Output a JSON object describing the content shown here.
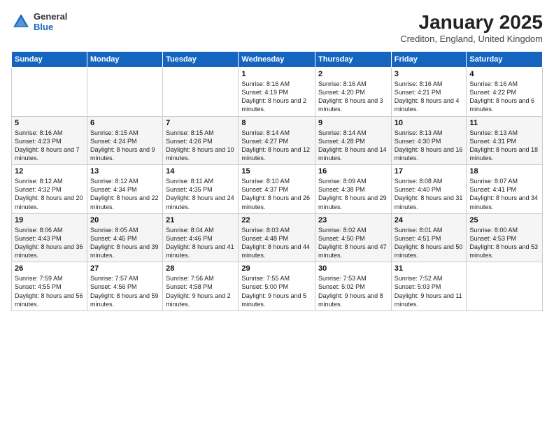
{
  "header": {
    "logo_general": "General",
    "logo_blue": "Blue",
    "month_title": "January 2025",
    "location": "Crediton, England, United Kingdom"
  },
  "weekdays": [
    "Sunday",
    "Monday",
    "Tuesday",
    "Wednesday",
    "Thursday",
    "Friday",
    "Saturday"
  ],
  "weeks": [
    [
      {
        "day": "",
        "info": ""
      },
      {
        "day": "",
        "info": ""
      },
      {
        "day": "",
        "info": ""
      },
      {
        "day": "1",
        "info": "Sunrise: 8:16 AM\nSunset: 4:19 PM\nDaylight: 8 hours and 2 minutes."
      },
      {
        "day": "2",
        "info": "Sunrise: 8:16 AM\nSunset: 4:20 PM\nDaylight: 8 hours and 3 minutes."
      },
      {
        "day": "3",
        "info": "Sunrise: 8:16 AM\nSunset: 4:21 PM\nDaylight: 8 hours and 4 minutes."
      },
      {
        "day": "4",
        "info": "Sunrise: 8:16 AM\nSunset: 4:22 PM\nDaylight: 8 hours and 6 minutes."
      }
    ],
    [
      {
        "day": "5",
        "info": "Sunrise: 8:16 AM\nSunset: 4:23 PM\nDaylight: 8 hours and 7 minutes."
      },
      {
        "day": "6",
        "info": "Sunrise: 8:15 AM\nSunset: 4:24 PM\nDaylight: 8 hours and 9 minutes."
      },
      {
        "day": "7",
        "info": "Sunrise: 8:15 AM\nSunset: 4:26 PM\nDaylight: 8 hours and 10 minutes."
      },
      {
        "day": "8",
        "info": "Sunrise: 8:14 AM\nSunset: 4:27 PM\nDaylight: 8 hours and 12 minutes."
      },
      {
        "day": "9",
        "info": "Sunrise: 8:14 AM\nSunset: 4:28 PM\nDaylight: 8 hours and 14 minutes."
      },
      {
        "day": "10",
        "info": "Sunrise: 8:13 AM\nSunset: 4:30 PM\nDaylight: 8 hours and 16 minutes."
      },
      {
        "day": "11",
        "info": "Sunrise: 8:13 AM\nSunset: 4:31 PM\nDaylight: 8 hours and 18 minutes."
      }
    ],
    [
      {
        "day": "12",
        "info": "Sunrise: 8:12 AM\nSunset: 4:32 PM\nDaylight: 8 hours and 20 minutes."
      },
      {
        "day": "13",
        "info": "Sunrise: 8:12 AM\nSunset: 4:34 PM\nDaylight: 8 hours and 22 minutes."
      },
      {
        "day": "14",
        "info": "Sunrise: 8:11 AM\nSunset: 4:35 PM\nDaylight: 8 hours and 24 minutes."
      },
      {
        "day": "15",
        "info": "Sunrise: 8:10 AM\nSunset: 4:37 PM\nDaylight: 8 hours and 26 minutes."
      },
      {
        "day": "16",
        "info": "Sunrise: 8:09 AM\nSunset: 4:38 PM\nDaylight: 8 hours and 29 minutes."
      },
      {
        "day": "17",
        "info": "Sunrise: 8:08 AM\nSunset: 4:40 PM\nDaylight: 8 hours and 31 minutes."
      },
      {
        "day": "18",
        "info": "Sunrise: 8:07 AM\nSunset: 4:41 PM\nDaylight: 8 hours and 34 minutes."
      }
    ],
    [
      {
        "day": "19",
        "info": "Sunrise: 8:06 AM\nSunset: 4:43 PM\nDaylight: 8 hours and 36 minutes."
      },
      {
        "day": "20",
        "info": "Sunrise: 8:05 AM\nSunset: 4:45 PM\nDaylight: 8 hours and 39 minutes."
      },
      {
        "day": "21",
        "info": "Sunrise: 8:04 AM\nSunset: 4:46 PM\nDaylight: 8 hours and 41 minutes."
      },
      {
        "day": "22",
        "info": "Sunrise: 8:03 AM\nSunset: 4:48 PM\nDaylight: 8 hours and 44 minutes."
      },
      {
        "day": "23",
        "info": "Sunrise: 8:02 AM\nSunset: 4:50 PM\nDaylight: 8 hours and 47 minutes."
      },
      {
        "day": "24",
        "info": "Sunrise: 8:01 AM\nSunset: 4:51 PM\nDaylight: 8 hours and 50 minutes."
      },
      {
        "day": "25",
        "info": "Sunrise: 8:00 AM\nSunset: 4:53 PM\nDaylight: 8 hours and 53 minutes."
      }
    ],
    [
      {
        "day": "26",
        "info": "Sunrise: 7:59 AM\nSunset: 4:55 PM\nDaylight: 8 hours and 56 minutes."
      },
      {
        "day": "27",
        "info": "Sunrise: 7:57 AM\nSunset: 4:56 PM\nDaylight: 8 hours and 59 minutes."
      },
      {
        "day": "28",
        "info": "Sunrise: 7:56 AM\nSunset: 4:58 PM\nDaylight: 9 hours and 2 minutes."
      },
      {
        "day": "29",
        "info": "Sunrise: 7:55 AM\nSunset: 5:00 PM\nDaylight: 9 hours and 5 minutes."
      },
      {
        "day": "30",
        "info": "Sunrise: 7:53 AM\nSunset: 5:02 PM\nDaylight: 9 hours and 8 minutes."
      },
      {
        "day": "31",
        "info": "Sunrise: 7:52 AM\nSunset: 5:03 PM\nDaylight: 9 hours and 11 minutes."
      },
      {
        "day": "",
        "info": ""
      }
    ]
  ]
}
